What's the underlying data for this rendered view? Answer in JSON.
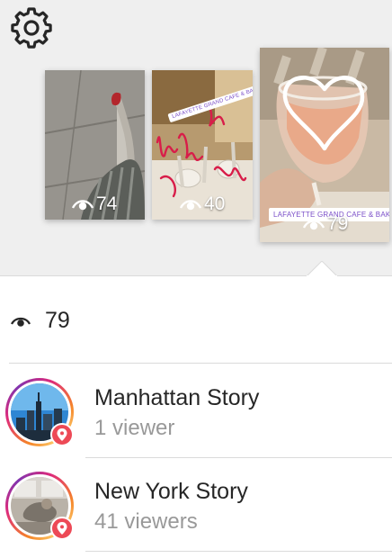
{
  "header": {
    "settings_icon": "gear-icon"
  },
  "stories_strip": {
    "items": [
      {
        "views": "74"
      },
      {
        "views": "40",
        "location_sticker": "LAFAYETTE GRAND CAFE & BAKERY"
      },
      {
        "views": "79",
        "location_sticker": "LAFAYETTE GRAND CAFE & BAKERY",
        "selected": true
      }
    ]
  },
  "summary": {
    "viewer_count": "79",
    "icon": "eye-icon"
  },
  "story_list": [
    {
      "title": "Manhattan Story",
      "subtitle": "1 viewer",
      "badge_icon": "location-pin-icon"
    },
    {
      "title": "New York Story",
      "subtitle": "41 viewers",
      "badge_icon": "location-pin-icon"
    }
  ],
  "colors": {
    "ring_gradient": [
      "#f58529",
      "#dd2a7b",
      "#8134af"
    ],
    "badge": "#ed4956",
    "secondary_text": "#999999",
    "sticker_text": "#7a4ec8"
  }
}
